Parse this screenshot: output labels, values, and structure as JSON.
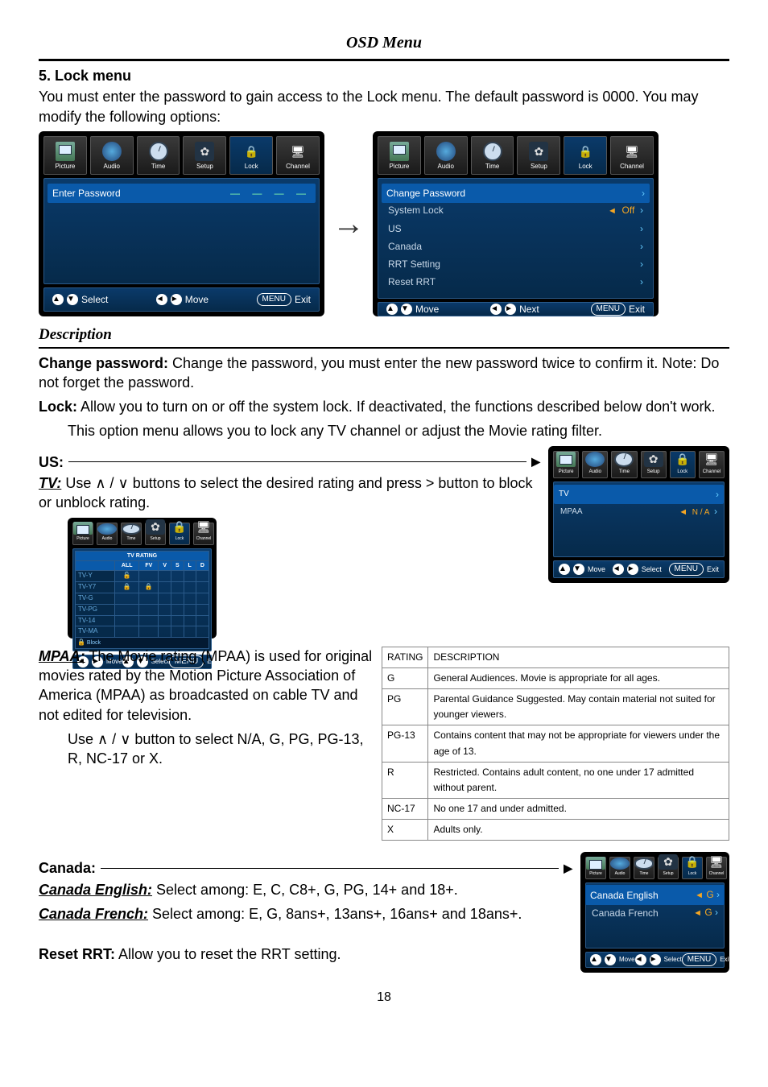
{
  "header": {
    "title": "OSD Menu"
  },
  "section": {
    "number_title": "5. Lock menu",
    "intro": "You must enter the password to gain access to the Lock menu. The default password is 0000. You may modify the following options:"
  },
  "tabs": [
    "Picture",
    "Audio",
    "Time",
    "Setup",
    "Lock",
    "Channel"
  ],
  "osd_enter": {
    "title": "Enter Password",
    "dashes": "— — — —",
    "footer": {
      "select": "Select",
      "move": "Move",
      "exit": "Exit",
      "menu": "MENU"
    }
  },
  "osd_lockmenu": {
    "items": [
      {
        "label": "Change Password",
        "value": ""
      },
      {
        "label": "System Lock",
        "value": "Off"
      },
      {
        "label": "US",
        "value": ""
      },
      {
        "label": "Canada",
        "value": ""
      },
      {
        "label": "RRT Setting",
        "value": ""
      },
      {
        "label": "Reset RRT",
        "value": ""
      }
    ],
    "footer": {
      "move": "Move",
      "next": "Next",
      "exit": "Exit",
      "menu": "MENU"
    }
  },
  "desc_heading": "Description",
  "descriptions": {
    "change_password": {
      "lead": "Change password:",
      "text": " Change the password, you must enter the new password twice to confirm it. Note: Do not forget the password."
    },
    "lock": {
      "lead": "Lock:",
      "text": " Allow you to turn on or off the system lock. If deactivated, the functions described below don't work."
    },
    "lock_sub": "This option menu allows you to lock any TV channel or adjust the Movie rating filter."
  },
  "us": {
    "label": "US:",
    "tv_lead": "TV:",
    "tv_text": " Use ∧ / ∨ buttons to select the desired rating and press > button to block or unblock rating.",
    "grid": {
      "top_header": "TV   RATING",
      "cols": [
        "ALL",
        "FV",
        "V",
        "S",
        "L",
        "D"
      ],
      "rows": [
        "TV-Y",
        "TV-Y7",
        "TV-G",
        "TV-PG",
        "TV-14",
        "TV-MA"
      ],
      "note": "Block"
    },
    "grid_footer": {
      "move": "Move",
      "select": "Select",
      "menu": "MENU",
      "exit": "Exit"
    },
    "osd_us_small": {
      "items": [
        {
          "label": "TV",
          "value": ""
        },
        {
          "label": "MPAA",
          "value": "N / A"
        }
      ],
      "footer": {
        "move": "Move",
        "select": "Select",
        "menu": "MENU",
        "exit": "Exit"
      }
    },
    "mpaa_lead": "MPAA:",
    "mpaa_text": " The Movie rating (MPAA) is used for original movies rated by the Motion Picture Association of America (MPAA) as broadcasted on cable TV and not edited for television.",
    "mpaa_text2": "Use ∧ / ∨ button to select N/A, G, PG, PG-13, R, NC-17 or X."
  },
  "rating_table": {
    "headers": [
      "RATING",
      "DESCRIPTION"
    ],
    "rows": [
      [
        "G",
        "General Audiences. Movie is appropriate for all ages."
      ],
      [
        "PG",
        "Parental Guidance Suggested. May contain material not suited for younger viewers."
      ],
      [
        "PG-13",
        "Contains content that may not be appropriate for viewers under the age of 13."
      ],
      [
        "R",
        "Restricted. Contains adult content, no one under 17 admitted without parent."
      ],
      [
        "NC-17",
        "No one 17 and under admitted."
      ],
      [
        "X",
        "Adults only."
      ]
    ]
  },
  "canada": {
    "label": "Canada:",
    "eng_lead": "Canada English:",
    "eng_text": " Select among: E, C, C8+, G, PG, 14+ and 18+.",
    "fr_lead": "Canada French:",
    "fr_text": " Select among: E, G, 8ans+, 13ans+, 16ans+ and 18ans+.",
    "osd": {
      "items": [
        {
          "label": "Canada English",
          "value": "G"
        },
        {
          "label": "Canada French",
          "value": "G"
        }
      ],
      "footer": {
        "move": "Move",
        "select": "Select",
        "menu": "MENU",
        "exit": "Exit"
      }
    }
  },
  "reset_rrt": {
    "lead": "Reset RRT:",
    "text": " Allow you to reset the RRT setting."
  },
  "page_number": "18"
}
